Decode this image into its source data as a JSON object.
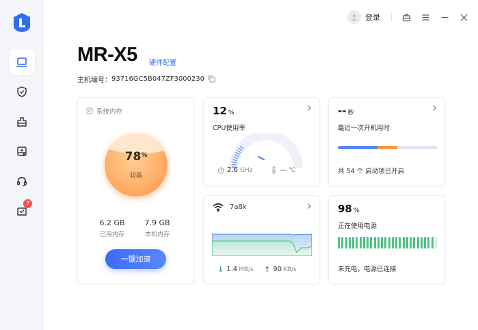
{
  "app": {
    "accent": "#3a6ff0",
    "nav": [
      {
        "name": "sidebar-item-device",
        "icon": "laptop-icon",
        "active": true
      },
      {
        "name": "sidebar-item-security",
        "icon": "shield-check-icon",
        "active": false
      },
      {
        "name": "sidebar-item-cleanup",
        "icon": "eraser-icon",
        "active": false
      },
      {
        "name": "sidebar-item-drivers",
        "icon": "drive-icon",
        "active": false
      },
      {
        "name": "sidebar-item-support",
        "icon": "headset-icon",
        "active": false
      },
      {
        "name": "sidebar-item-messages",
        "icon": "inbox-icon",
        "active": false,
        "badge": "7"
      }
    ]
  },
  "titlebar": {
    "login_label": "登录"
  },
  "header": {
    "model": "MR-X5",
    "hw_config_link": "硬件配置",
    "serial_label": "主机编号：",
    "serial_value": "93716GC5B047ZF3000230"
  },
  "memory": {
    "title": "系统内存",
    "percent": "78",
    "percent_unit": "%",
    "state": "较高",
    "used_value": "6.2 GB",
    "used_label": "已用内存",
    "total_value": "7.9 GB",
    "total_label": "本机内存",
    "boost_button": "一键加速",
    "usage_fraction": 0.78
  },
  "cpu": {
    "usage": "12",
    "usage_unit": "%",
    "label": "CPU使用率",
    "freq_value": "2.6",
    "freq_unit": "GHz",
    "temp_value": "—",
    "temp_unit": "℃",
    "usage_fraction": 0.12
  },
  "boot": {
    "value": "--",
    "unit": "秒",
    "label": "最近一次开机用时",
    "segments": [
      {
        "fraction": 0.4,
        "color": "#5b86f2"
      },
      {
        "fraction": 0.2,
        "color": "#f59a45"
      },
      {
        "fraction": 0.4,
        "color": "#dfe5ee"
      }
    ],
    "note": "共 54 个 启动项已开启"
  },
  "network": {
    "name": "7a8k",
    "down_value": "1.4",
    "down_unit": "MB/s",
    "up_value": "90",
    "up_unit": "KB/s"
  },
  "power": {
    "value": "98",
    "unit": "%",
    "label": "正在使用电源",
    "level_fraction": 0.98,
    "note": "未充电，电源已连接"
  }
}
